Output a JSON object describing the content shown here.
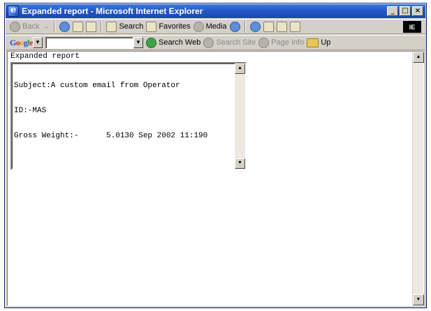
{
  "window": {
    "title": "Expanded report - Microsoft Internet Explorer",
    "icon": "ie-icon",
    "controls": {
      "minimize": "_",
      "maximize": "□",
      "close": "×"
    }
  },
  "toolbar": {
    "back": "Back",
    "forward": "→",
    "search": "Search",
    "favorites": "Favorites",
    "media": "Media",
    "throbber": "IE"
  },
  "google_bar": {
    "logo": "Google",
    "search_value": "",
    "search_web": "Search Web",
    "search_site": "Search Site",
    "page_info": "Page Info",
    "up": "Up"
  },
  "page": {
    "heading": "Expanded report",
    "report_lines": [
      "Subject:A custom email from Operator",
      "ID:-MAS",
      "Gross Weight:-      5.0130 Sep 2002 11:190"
    ]
  },
  "colors": {
    "titlebar": "#2458c8",
    "chrome": "#d4d0c8",
    "page_bg": "#ffffff"
  }
}
